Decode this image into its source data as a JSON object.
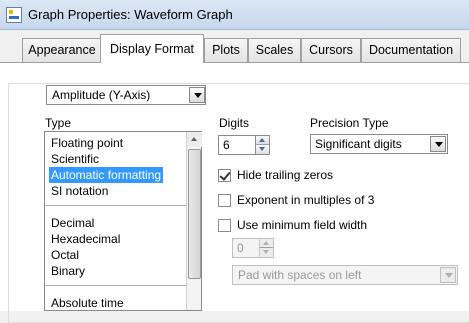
{
  "window": {
    "title": "Graph Properties: Waveform Graph"
  },
  "tabs": [
    {
      "label": "Appearance"
    },
    {
      "label": "Display Format",
      "active": true
    },
    {
      "label": "Plots"
    },
    {
      "label": "Scales"
    },
    {
      "label": "Cursors"
    },
    {
      "label": "Documentation"
    }
  ],
  "axis_selector": {
    "value": "Amplitude (Y-Axis)"
  },
  "type_section": {
    "label": "Type",
    "items": [
      "Floating point",
      "Scientific",
      "Automatic formatting",
      "SI notation",
      "Decimal",
      "Hexadecimal",
      "Octal",
      "Binary",
      "Absolute time"
    ],
    "selected": "Automatic formatting"
  },
  "digits": {
    "label": "Digits",
    "value": "6"
  },
  "precision": {
    "label": "Precision Type",
    "value": "Significant digits"
  },
  "options": {
    "hide_trailing_zeros": {
      "label": "Hide trailing zeros",
      "checked": true
    },
    "exponent_multiples_3": {
      "label": "Exponent in multiples of 3",
      "checked": false
    },
    "use_min_field_width": {
      "label": "Use minimum field width",
      "checked": false
    }
  },
  "min_field_width": {
    "value": "0"
  },
  "padding": {
    "value": "Pad with spaces on left"
  },
  "colors": {
    "selection": "#3399ff",
    "titlebar": "#dbe7f5"
  }
}
